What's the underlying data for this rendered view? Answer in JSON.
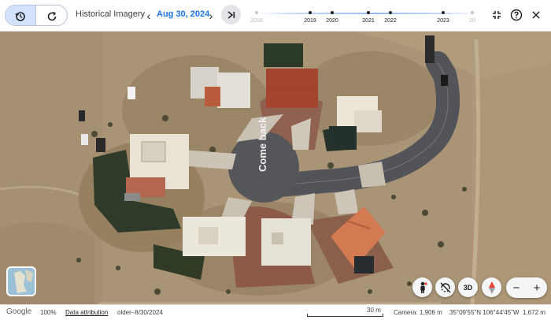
{
  "toolbar": {
    "title": "Historical Imagery",
    "date": "Aug 30, 2024",
    "timeline_years": [
      {
        "label": "2018",
        "faint": true
      },
      {
        "label": "2019",
        "faint": false
      },
      {
        "label": "2020",
        "faint": false
      },
      {
        "label": "2021",
        "faint": false
      },
      {
        "label": "2022",
        "faint": false
      },
      {
        "label": "2023",
        "faint": false
      },
      {
        "label": "20",
        "faint": true
      }
    ]
  },
  "map": {
    "road_text": "Come back",
    "scale_label": "30 m"
  },
  "controls": {
    "three_d_label": "3D",
    "zoom_out_label": "−",
    "zoom_in_label": "+"
  },
  "status": {
    "brand": "Google",
    "zoom_percent": "100%",
    "attribution_link": "Data attribution",
    "imagery_range": "older–8/30/2024",
    "camera": "Camera: 1,906 m",
    "coordinates": "35°09'55\"N 106°44'45\"W",
    "elevation": "1,672 m"
  },
  "colors": {
    "accent": "#1a73e8",
    "selected_background": "#d3e3fd",
    "toolbar_background": "#ffffff",
    "desert": "#a99476",
    "asphalt": "#54565a"
  }
}
